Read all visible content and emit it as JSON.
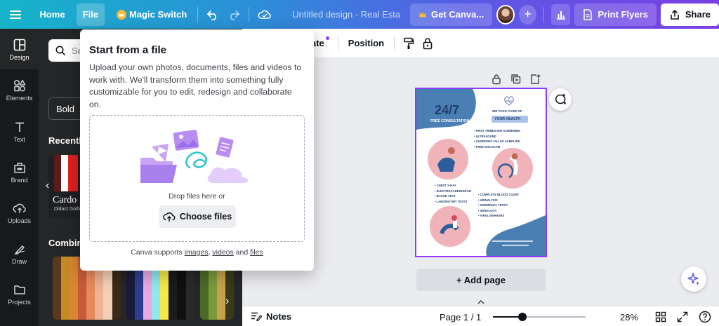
{
  "topbar": {
    "home": "Home",
    "file": "File",
    "magic_switch": "Magic Switch",
    "title": "Untitled design - Real Estate ...",
    "get_canva": "Get Canva...",
    "print": "Print Flyers",
    "share": "Share"
  },
  "rail": {
    "items": [
      {
        "label": "Design",
        "icon": "design-icon"
      },
      {
        "label": "Elements",
        "icon": "elements-icon"
      },
      {
        "label": "Text",
        "icon": "text-icon"
      },
      {
        "label": "Brand",
        "icon": "brand-icon"
      },
      {
        "label": "Uploads",
        "icon": "uploads-icon"
      },
      {
        "label": "Draw",
        "icon": "draw-icon"
      },
      {
        "label": "Projects",
        "icon": "projects-icon"
      }
    ]
  },
  "panel": {
    "search_placeholder": "Se",
    "chip": "Bold",
    "recently_title": "Recently",
    "font_name": "Cardo",
    "font_sub": "Didact Goth",
    "combinations_title": "Combina"
  },
  "canvas_toolbar": {
    "animate_partial": "ate",
    "position": "Position"
  },
  "popover": {
    "title": "Start from a file",
    "description": "Upload your own photos, documents, files and videos to work with. We'll transform them into something fully customizable for you to edit, redesign and collaborate on.",
    "drop_text": "Drop files here or",
    "choose_button": "Choose files",
    "supports_prefix": "Canva supports ",
    "link_images": "images",
    "sep1": ", ",
    "link_videos": "videos",
    "sep2": " and ",
    "link_files": "files"
  },
  "flyer": {
    "headline": "24/7",
    "sub": "FREE CONSULTATION",
    "tagline": "WE TAKE CARE OF",
    "badge": "YOUR HEALTH",
    "list1": [
      "FIRST TRIMESTER SCREENING",
      "ULTRASOUND",
      "CHORIONIC VILLUS SAMPLING",
      "FREE DNA EXAM"
    ],
    "list2": [
      "CHEST X-RAY",
      "ELECTROCARDIOGRAM",
      "BLOOD TEST",
      "LABORATORY TESTS"
    ],
    "list3": [
      "COMPLETE BLOOD COUNT",
      "URINALYSIS",
      "HORMONAL TESTS",
      "SEROLOGY",
      "VIRAL MARKERS"
    ]
  },
  "canvas": {
    "add_page": "+ Add page"
  },
  "bottombar": {
    "notes": "Notes",
    "page": "Page 1 / 1",
    "zoom": "28%",
    "zoom_level": 0.32
  },
  "colors": {
    "accent": "#8b3dff",
    "flyer_blue": "#4a7fb3",
    "flyer_pink": "#f0b3ba"
  }
}
